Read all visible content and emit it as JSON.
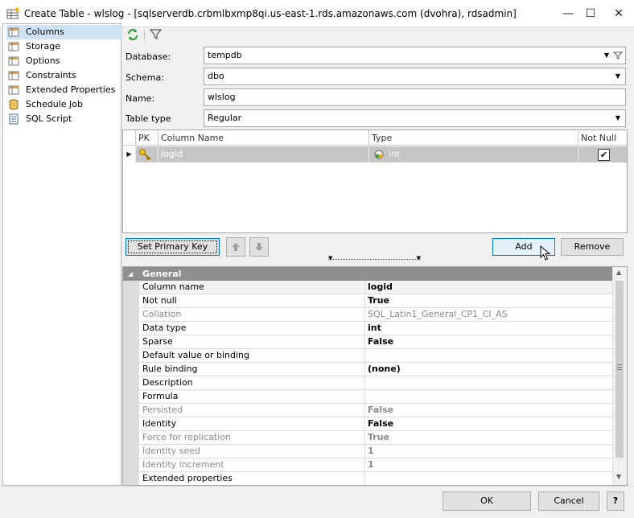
{
  "window": {
    "title": "Create Table - wlslog - [sqlserverdb.crbmlbxmp8qi.us-east-1.rds.amazonaws.com (dvohra), rdsadmin]",
    "minimize": "—",
    "maximize": "☐",
    "close": "✕"
  },
  "sidebar": {
    "items": [
      {
        "label": "Columns"
      },
      {
        "label": "Storage"
      },
      {
        "label": "Options"
      },
      {
        "label": "Constraints"
      },
      {
        "label": "Extended Properties"
      },
      {
        "label": "Schedule Job"
      },
      {
        "label": "SQL Script"
      }
    ]
  },
  "form": {
    "database": {
      "label": "Database:",
      "value": "tempdb"
    },
    "schema": {
      "label": "Schema:",
      "value": "dbo"
    },
    "name": {
      "label": "Name:",
      "value": "wlslog"
    },
    "table_type": {
      "label": "Table type",
      "value": "Regular"
    }
  },
  "grid": {
    "headers": {
      "pk": "PK",
      "column_name": "Column Name",
      "type": "Type",
      "not_null": "Not Null"
    },
    "rows": [
      {
        "column_name": "logid",
        "type": "int",
        "not_null": "✔"
      }
    ]
  },
  "buttons": {
    "set_primary_key": "Set Primary Key",
    "add": "Add",
    "remove": "Remove",
    "ok": "OK",
    "cancel": "Cancel",
    "help": "?"
  },
  "properties": {
    "category": "General",
    "rows": [
      {
        "name": "Column name",
        "value": "logid"
      },
      {
        "name": "Not null",
        "value": "True"
      },
      {
        "name": "Collation",
        "value": "SQL_Latin1_General_CP1_CI_AS"
      },
      {
        "name": "Data type",
        "value": "int"
      },
      {
        "name": "Sparse",
        "value": "False"
      },
      {
        "name": "Default value or binding",
        "value": ""
      },
      {
        "name": "Rule binding",
        "value": "(none)"
      },
      {
        "name": "Description",
        "value": ""
      },
      {
        "name": "Formula",
        "value": ""
      },
      {
        "name": "Persisted",
        "value": "False"
      },
      {
        "name": "Identity",
        "value": "False"
      },
      {
        "name": "Force for replication",
        "value": "True"
      },
      {
        "name": "Identity seed",
        "value": "1"
      },
      {
        "name": "Identity increment",
        "value": "1"
      },
      {
        "name": "Extended properties",
        "value": ""
      }
    ]
  }
}
